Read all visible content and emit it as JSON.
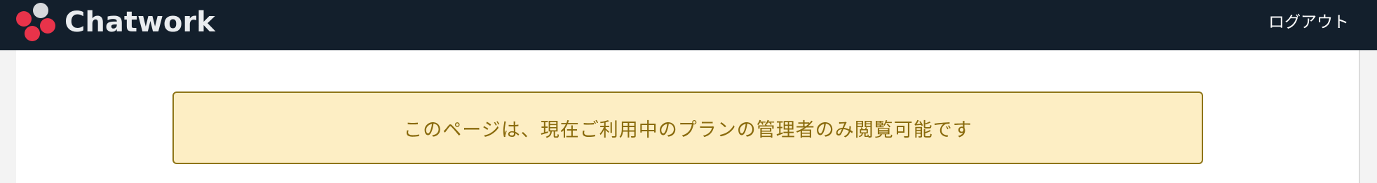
{
  "header": {
    "brand": "Chatwork",
    "logout_label": "ログアウト"
  },
  "alert": {
    "message": "このページは、現在ご利用中のプランの管理者のみ閲覧可能です"
  },
  "colors": {
    "header_bg": "#131f2c",
    "alert_bg": "#fdeec4",
    "alert_border": "#8f7518",
    "alert_text": "#8a6b0d",
    "logo_red": "#e8334a",
    "logo_gray": "#d7d9dc"
  },
  "icons": {
    "logo": "chatwork-logo-icon"
  }
}
